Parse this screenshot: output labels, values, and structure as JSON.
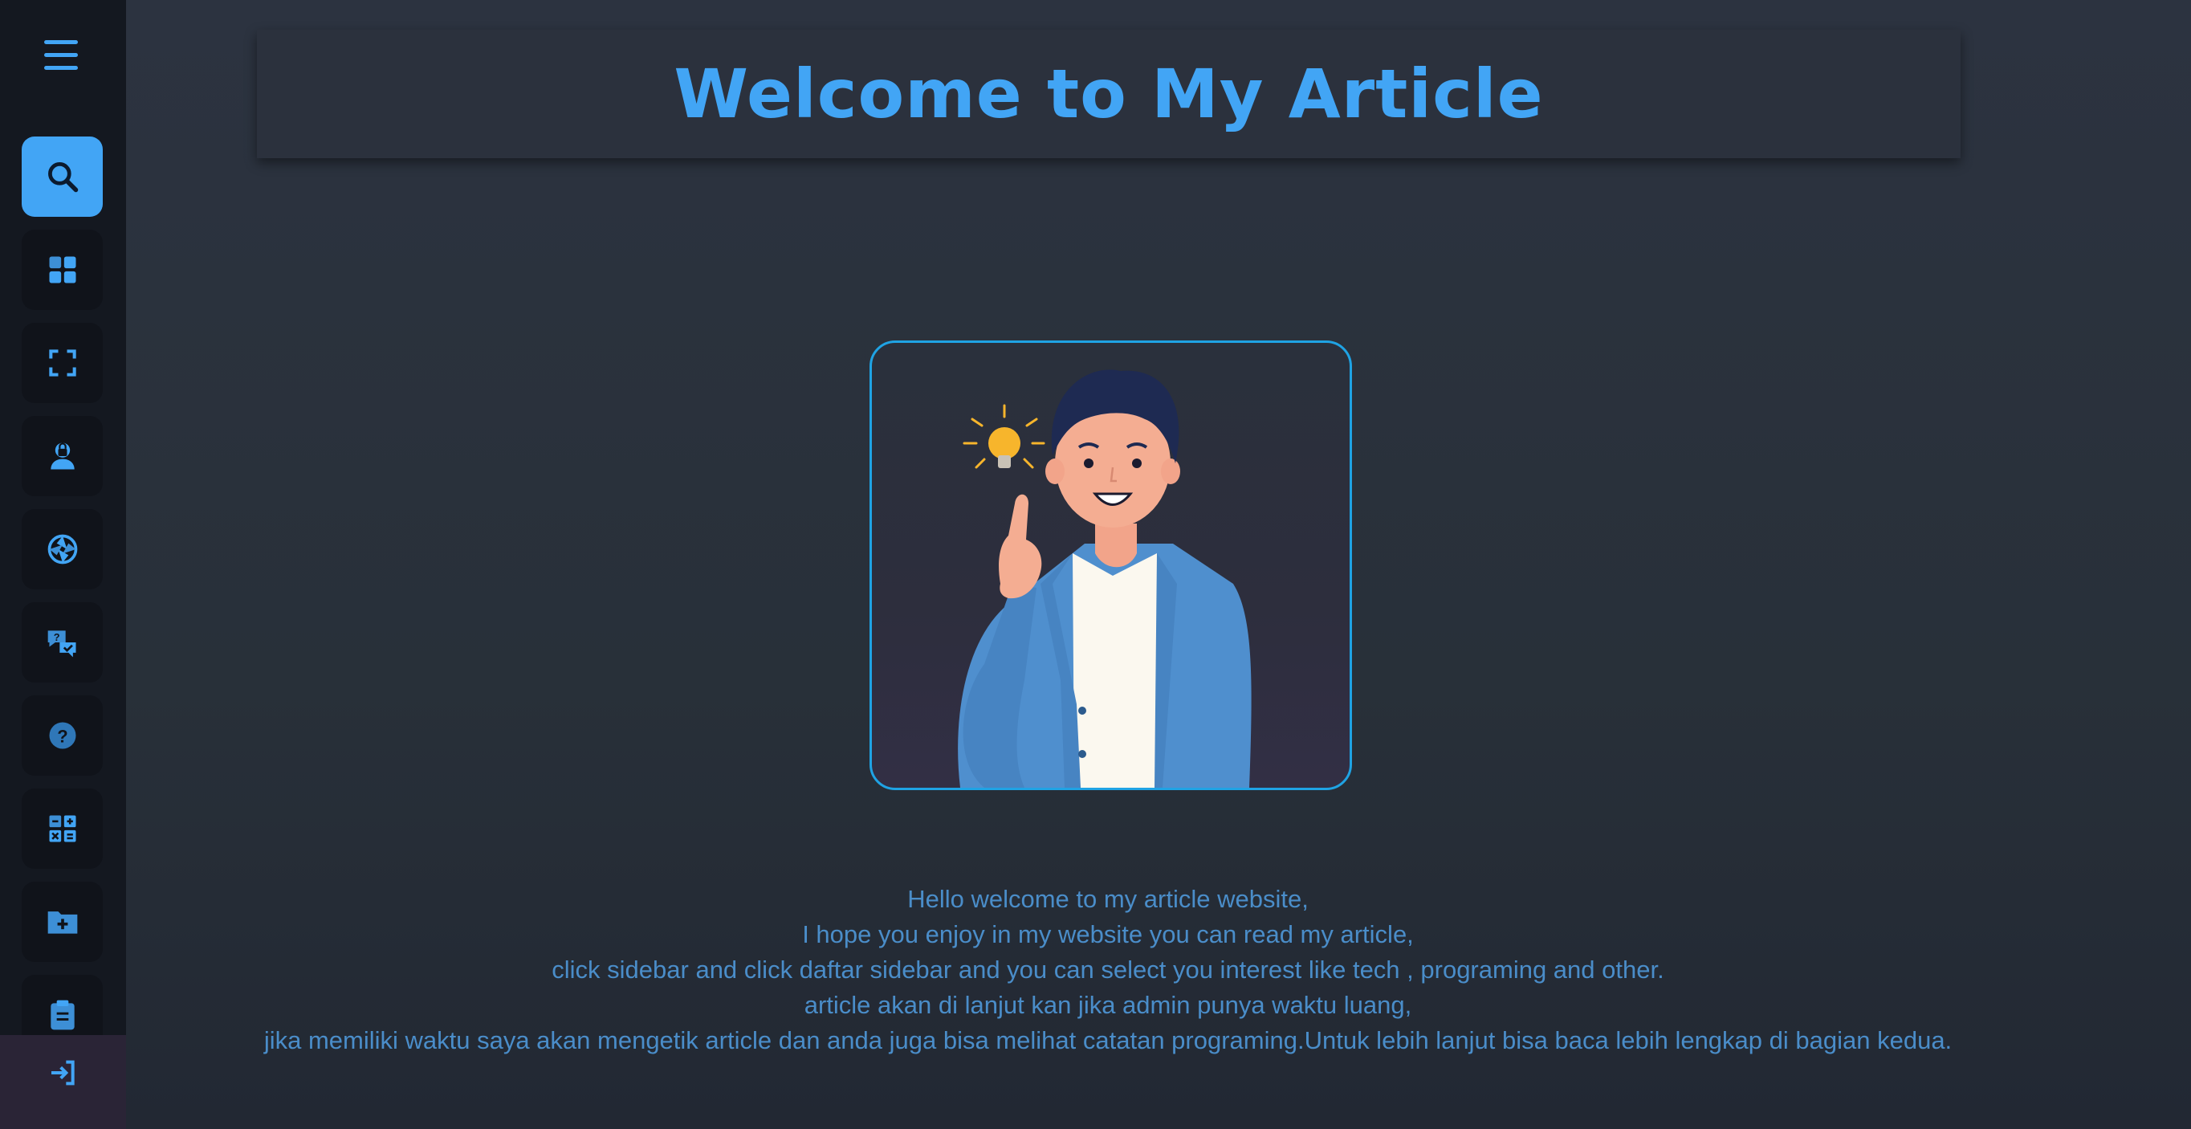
{
  "header": {
    "title": "Welcome to My Article"
  },
  "sidebar": {
    "menu_icon": "hamburger-menu-icon",
    "items": [
      {
        "name": "search",
        "icon": "search-icon",
        "active": true
      },
      {
        "name": "dashboard",
        "icon": "grid-icon",
        "active": false
      },
      {
        "name": "fullscreen",
        "icon": "expand-icon",
        "active": false
      },
      {
        "name": "security",
        "icon": "user-lock-icon",
        "active": false
      },
      {
        "name": "aperture",
        "icon": "shutter-icon",
        "active": false
      },
      {
        "name": "qa",
        "icon": "question-answer-icon",
        "active": false
      },
      {
        "name": "help",
        "icon": "help-circle-icon",
        "active": false
      },
      {
        "name": "calculator",
        "icon": "calculator-icon",
        "active": false
      },
      {
        "name": "new-folder",
        "icon": "folder-plus-icon",
        "active": false
      },
      {
        "name": "clipboard",
        "icon": "clipboard-icon",
        "active": false
      }
    ],
    "login_icon": "sign-in-icon"
  },
  "hero": {
    "image": "person-idea-illustration"
  },
  "intro": {
    "lines": [
      "Hello welcome to my article website,",
      "I hope you enjoy in my website you can read my article,",
      "click sidebar and click daftar sidebar and you can select you interest like tech , programing and other.",
      "article akan di lanjut kan jika admin punya waktu luang,",
      "jika memiliki waktu saya akan mengetik article dan anda juga bisa melihat catatan programing.Untuk lebih lanjut bisa baca lebih lengkap di bagian kedua."
    ]
  },
  "colors": {
    "accent": "#42a5f5",
    "text": "#4a8dc9",
    "sidebar_bg": "#141820",
    "page_bg": "#2a303c",
    "frame_border": "#1fa3e4"
  }
}
